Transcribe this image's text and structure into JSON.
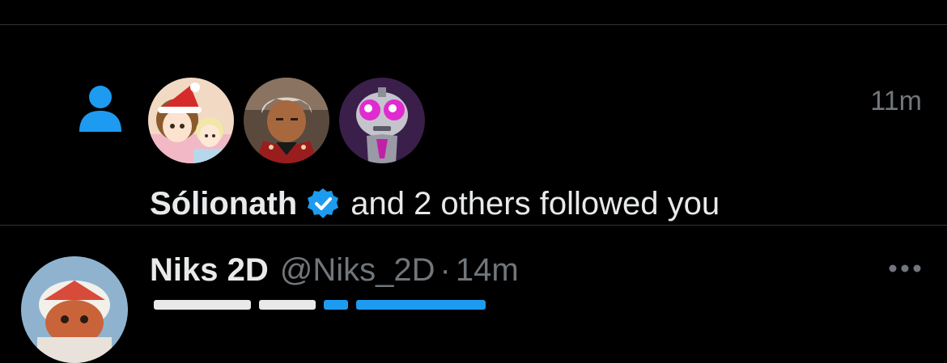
{
  "colors": {
    "background": "#000000",
    "divider": "#2f3336",
    "accent": "#1d9bf0",
    "primary_text": "#e7e9ea",
    "secondary_text": "#71767b"
  },
  "notification": {
    "type_icon": "person-follow-icon",
    "time": "11m",
    "avatars": [
      {
        "name": "anime-girls-santa-hat-avatar"
      },
      {
        "name": "anime-archer-avatar"
      },
      {
        "name": "gir-robot-avatar"
      }
    ],
    "user_name": "Sólionath",
    "verified_icon": "verified-badge-icon",
    "text": "and 2 others followed you"
  },
  "tweet": {
    "display_name": "Niks 2D",
    "handle": "@Niks_2D",
    "separator": "·",
    "time": "14m",
    "more_icon": "more-options-icon"
  }
}
